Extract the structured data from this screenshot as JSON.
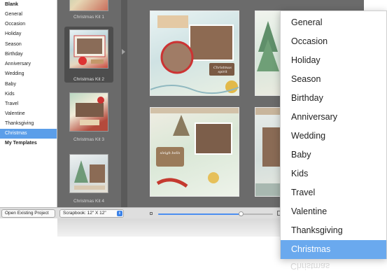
{
  "sidebar": {
    "items": [
      {
        "label": "Blank",
        "bold": true
      },
      {
        "label": "General"
      },
      {
        "label": "Occasion"
      },
      {
        "label": "Holiday"
      },
      {
        "label": "Season"
      },
      {
        "label": "Birthday"
      },
      {
        "label": "Anniversary"
      },
      {
        "label": "Wedding"
      },
      {
        "label": "Baby"
      },
      {
        "label": "Kids"
      },
      {
        "label": "Travel"
      },
      {
        "label": "Valentine"
      },
      {
        "label": "Thanksgiving"
      },
      {
        "label": "Christmas",
        "selected": true
      },
      {
        "label": "My Templates",
        "bold": true
      }
    ]
  },
  "kits": [
    {
      "label": "Christmas Kit 1"
    },
    {
      "label": "Christmas Kit 2",
      "selected": true
    },
    {
      "label": "Christmas Kit 3"
    },
    {
      "label": "Christmas Kit 4"
    }
  ],
  "pages": [
    {
      "caption": "Christmas spirit"
    },
    {
      "caption": ""
    },
    {
      "caption": "sleigh bells"
    },
    {
      "caption": ""
    }
  ],
  "bottom": {
    "open_button": "Open Existing Project",
    "scrapbook_select": "Scrapbook: 12\" X 12\"",
    "zoom_level": 0.72
  },
  "menu": {
    "items": [
      {
        "label": "General"
      },
      {
        "label": "Occasion"
      },
      {
        "label": "Holiday"
      },
      {
        "label": "Season"
      },
      {
        "label": "Birthday"
      },
      {
        "label": "Anniversary"
      },
      {
        "label": "Wedding"
      },
      {
        "label": "Baby"
      },
      {
        "label": "Kids"
      },
      {
        "label": "Travel"
      },
      {
        "label": "Valentine"
      },
      {
        "label": "Thanksgiving"
      },
      {
        "label": "Christmas",
        "selected": true
      }
    ]
  },
  "colors": {
    "selection_blue": "#5b9ee9",
    "menu_selection": "#6aa9ee",
    "slider_blue": "#4c8ef0",
    "dark_panel": "#6b6b6b"
  }
}
